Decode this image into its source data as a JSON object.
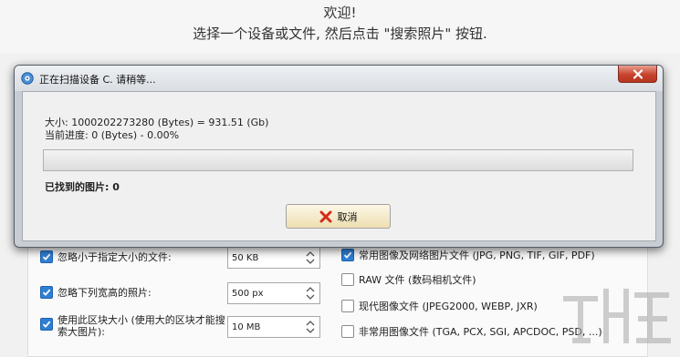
{
  "app": {
    "welcome": "欢迎!",
    "instruction": "选择一个设备或文件, 然后点击 \"搜索照片\" 按钮."
  },
  "options_left": [
    {
      "label": "忽略小于指定大小的文件:",
      "checked": true,
      "value": "50 KB"
    },
    {
      "label": "忽略下列宽高的照片:",
      "checked": true,
      "value": "500 px"
    },
    {
      "label": "使用此区块大小 (使用大的区块才能搜索大图片):",
      "checked": true,
      "value": "10 MB"
    }
  ],
  "options_right": [
    {
      "label": "常用图像及网络图片文件 (JPG, PNG, TIF, GIF, PDF)",
      "checked": true
    },
    {
      "label": "RAW 文件 (数码相机文件)",
      "checked": false
    },
    {
      "label": "现代图像文件 (JPEG2000, WEBP, JXR)",
      "checked": false
    },
    {
      "label": "非常用图像文件 (TGA, PCX, SGI, APCDOC, PSD, ...)",
      "checked": false
    }
  ],
  "dialog": {
    "title": "正在扫描设备 C. 请稍等...",
    "size_text": "大小: 1000202273280 (Bytes) = 931.51 (Gb)",
    "progress_text": "当前进度: 0 (Bytes) - 0.00%",
    "progress_percent": 0,
    "found_label": "已找到的图片:",
    "found_count": "0",
    "cancel_label": "取消"
  },
  "colors": {
    "accent": "#2f7fd3",
    "close": "#c7432d",
    "progress": "#37b34a"
  },
  "icons": {
    "app": "app-disc-icon",
    "close": "close-x-icon",
    "cancel": "red-x-icon",
    "check": "checkmark-icon",
    "spinner": "up-down-arrows-icon"
  }
}
